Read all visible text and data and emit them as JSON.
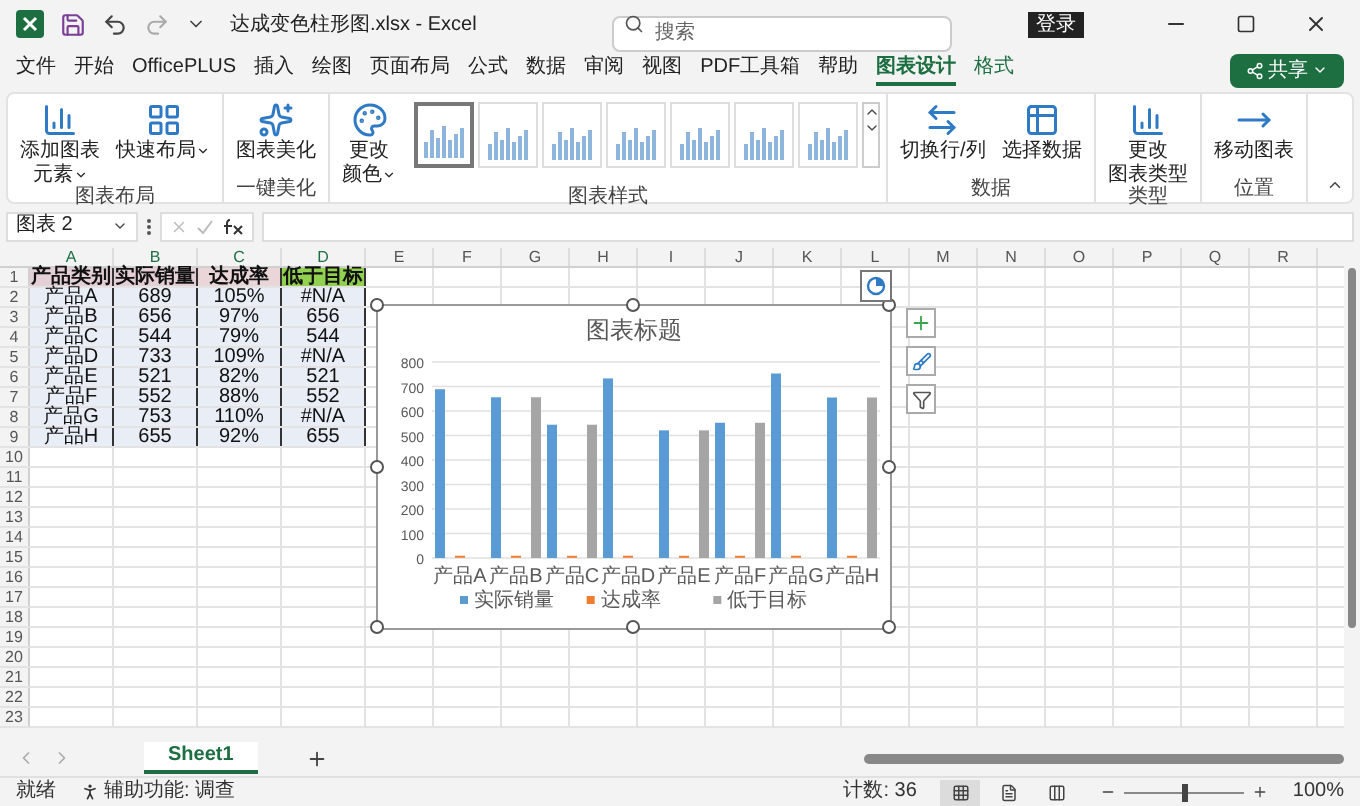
{
  "window": {
    "title": "达成变色柱形图.xlsx - Excel",
    "search_placeholder": "搜索",
    "sign_in": "登录"
  },
  "menu_tabs": [
    {
      "label": "文件",
      "selected": false,
      "contextual": false
    },
    {
      "label": "开始",
      "selected": false,
      "contextual": false
    },
    {
      "label": "OfficePLUS",
      "selected": false,
      "contextual": false
    },
    {
      "label": "插入",
      "selected": false,
      "contextual": false
    },
    {
      "label": "绘图",
      "selected": false,
      "contextual": false
    },
    {
      "label": "页面布局",
      "selected": false,
      "contextual": false
    },
    {
      "label": "公式",
      "selected": false,
      "contextual": false
    },
    {
      "label": "数据",
      "selected": false,
      "contextual": false
    },
    {
      "label": "审阅",
      "selected": false,
      "contextual": false
    },
    {
      "label": "视图",
      "selected": false,
      "contextual": false
    },
    {
      "label": "PDF工具箱",
      "selected": false,
      "contextual": false
    },
    {
      "label": "帮助",
      "selected": false,
      "contextual": false
    },
    {
      "label": "图表设计",
      "selected": true,
      "contextual": true
    },
    {
      "label": "格式",
      "selected": false,
      "contextual": true
    }
  ],
  "share_button": "共享",
  "ribbon": {
    "groups": [
      {
        "label": "图表布局",
        "buttons": [
          {
            "kind": "add",
            "lines": [
              "添加图表",
              "元素"
            ],
            "dropdown": true
          },
          {
            "kind": "layout",
            "lines": [
              "快速布局"
            ],
            "dropdown": true
          }
        ]
      },
      {
        "label": "一键美化",
        "buttons": [
          {
            "kind": "beautify",
            "lines": [
              "图表美化"
            ],
            "dropdown": false
          }
        ]
      },
      {
        "label": "图表样式",
        "buttons": [
          {
            "kind": "colors",
            "lines": [
              "更改",
              "颜色"
            ],
            "dropdown": true
          }
        ],
        "styles": [
          {
            "selected": true
          },
          {
            "selected": false
          },
          {
            "selected": false
          },
          {
            "selected": false
          },
          {
            "selected": false
          },
          {
            "selected": false
          },
          {
            "selected": false
          }
        ]
      },
      {
        "label": "数据",
        "buttons": [
          {
            "kind": "switch",
            "lines": [
              "切换行/列"
            ],
            "dropdown": false
          },
          {
            "kind": "select",
            "lines": [
              "选择数据"
            ],
            "dropdown": false
          }
        ]
      },
      {
        "label": "类型",
        "buttons": [
          {
            "kind": "type",
            "lines": [
              "更改",
              "图表类型"
            ],
            "dropdown": false
          }
        ]
      },
      {
        "label": "位置",
        "buttons": [
          {
            "kind": "move",
            "lines": [
              "移动图表"
            ],
            "dropdown": false
          }
        ]
      }
    ]
  },
  "formula_bar": {
    "name_box": "图表 2"
  },
  "sheet": {
    "columns": [
      "A",
      "B",
      "C",
      "D",
      "E",
      "F",
      "G",
      "H",
      "I",
      "J",
      "K",
      "L",
      "M",
      "N",
      "O",
      "P",
      "Q",
      "R"
    ],
    "row_numbers": [
      "1",
      "2",
      "3",
      "4",
      "5",
      "6",
      "7",
      "8",
      "9",
      "10",
      "11",
      "12",
      "13",
      "14",
      "15",
      "16",
      "17",
      "18",
      "19",
      "20",
      "21",
      "22",
      "23"
    ],
    "rows": [
      [
        "产品类别",
        "实际销量",
        "达成率",
        "低于目标"
      ],
      [
        "产品A",
        "689",
        "105%",
        "#N/A"
      ],
      [
        "产品B",
        "656",
        "97%",
        "656"
      ],
      [
        "产品C",
        "544",
        "79%",
        "544"
      ],
      [
        "产品D",
        "733",
        "109%",
        "#N/A"
      ],
      [
        "产品E",
        "521",
        "82%",
        "521"
      ],
      [
        "产品F",
        "552",
        "88%",
        "552"
      ],
      [
        "产品G",
        "753",
        "110%",
        "#N/A"
      ],
      [
        "产品H",
        "655",
        "92%",
        "655"
      ]
    ]
  },
  "chart": {
    "chart_data": {
      "type": "bar",
      "title": "图表标题",
      "categories": [
        "产品A",
        "产品B",
        "产品C",
        "产品D",
        "产品E",
        "产品F",
        "产品G",
        "产品H"
      ],
      "series": [
        {
          "name": "实际销量",
          "color": "#5b9bd5",
          "values": [
            689,
            656,
            544,
            733,
            521,
            552,
            753,
            655
          ]
        },
        {
          "name": "达成率",
          "color": "#ed7d31",
          "values": [
            1.05,
            0.97,
            0.79,
            1.09,
            0.82,
            0.88,
            1.1,
            0.92
          ]
        },
        {
          "name": "低于目标",
          "color": "#a5a5a5",
          "values": [
            null,
            656,
            544,
            null,
            521,
            552,
            null,
            655
          ]
        }
      ],
      "ylim": [
        0,
        800
      ],
      "grid": true,
      "legend": "bottom",
      "yticks": [
        0,
        100,
        200,
        300,
        400,
        500,
        600,
        700,
        800
      ]
    }
  },
  "sheet_tabs": [
    {
      "label": "Sheet1",
      "selected": true
    }
  ],
  "status_bar": {
    "ready": "就绪",
    "accessibility": "辅助功能: 调查",
    "count": "计数: 36",
    "zoom": "100%",
    "zoom_slider": {
      "level": 0.5
    },
    "views": [
      {
        "kind": "normal",
        "selected": true
      },
      {
        "kind": "page_layout",
        "selected": false
      },
      {
        "kind": "page_break",
        "selected": false
      }
    ]
  }
}
